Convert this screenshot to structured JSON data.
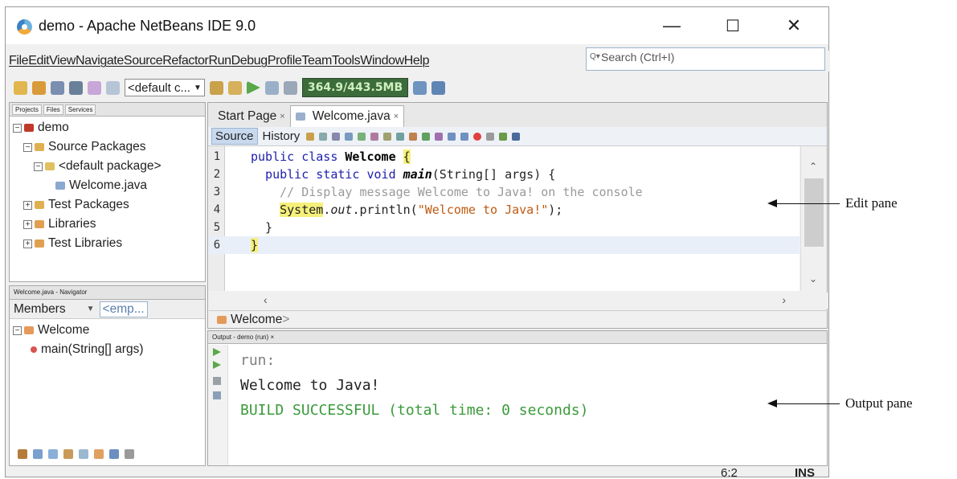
{
  "window": {
    "title": "demo - Apache NetBeans IDE 9.0",
    "minimize": "—",
    "maximize": "☐",
    "close": "✕"
  },
  "menu": [
    "File",
    "Edit",
    "View",
    "Navigate",
    "Source",
    "Refactor",
    "Run",
    "Debug",
    "Profile",
    "Team",
    "Tools",
    "Window",
    "Help"
  ],
  "search": {
    "placeholder": "Search (Ctrl+I)"
  },
  "toolbar": {
    "config": "<default c...",
    "memory": "364.9/443.5MB"
  },
  "projects_panel": {
    "tabs": [
      "Projects",
      "Files",
      "Services"
    ],
    "tree": [
      {
        "label": "demo",
        "toggle": "−",
        "indent": 0
      },
      {
        "label": "Source Packages",
        "toggle": "−",
        "indent": 1
      },
      {
        "label": "<default package>",
        "toggle": "−",
        "indent": 2
      },
      {
        "label": "Welcome.java",
        "toggle": "",
        "indent": 3
      },
      {
        "label": "Test Packages",
        "toggle": "+",
        "indent": 1
      },
      {
        "label": "Libraries",
        "toggle": "+",
        "indent": 1
      },
      {
        "label": "Test Libraries",
        "toggle": "+",
        "indent": 1
      }
    ]
  },
  "navigator": {
    "title": "Welcome.java - Navigator",
    "members_label": "Members",
    "filter": "<emp...",
    "class_name": "Welcome",
    "method": "main(String[] args)"
  },
  "editor": {
    "tabs": [
      "Start Page",
      "Welcome.java"
    ],
    "source_tab": "Source",
    "history_tab": "History",
    "breadcrumb": "Welcome"
  },
  "code": [
    {
      "n": "1",
      "parts": [
        [
          "kw",
          "public class "
        ],
        [
          "bold",
          "Welcome"
        ],
        [
          "",
          " "
        ],
        [
          "hl",
          "{"
        ]
      ]
    },
    {
      "n": "2",
      "parts": [
        [
          "kw",
          "  public static void "
        ],
        [
          "bold it",
          "main"
        ],
        [
          "",
          "(String[] args) {"
        ]
      ]
    },
    {
      "n": "3",
      "parts": [
        [
          "cm",
          "    // Display message Welcome to Java! on the console"
        ]
      ]
    },
    {
      "n": "4",
      "parts": [
        [
          "",
          "    "
        ],
        [
          "hl",
          "System"
        ],
        [
          "",
          "."
        ],
        [
          "it",
          "out"
        ],
        [
          "",
          ".println("
        ],
        [
          "str",
          "\"Welcome to Java!\""
        ],
        [
          "",
          ");"
        ]
      ]
    },
    {
      "n": "5",
      "parts": [
        [
          "",
          "  }"
        ]
      ]
    },
    {
      "n": "6",
      "parts": [
        [
          "hl",
          "}"
        ]
      ]
    }
  ],
  "output": {
    "title": "Output - demo (run)",
    "lines": [
      {
        "text": "run:",
        "color": "#808080"
      },
      {
        "text": "Welcome to Java!",
        "color": "#222222"
      },
      {
        "text": "BUILD SUCCESSFUL (total time: 0 seconds)",
        "color": "#3a9a3a"
      }
    ]
  },
  "status": {
    "position": "6:2",
    "mode": "INS"
  },
  "annotations": {
    "edit": "Edit pane",
    "output": "Output pane"
  }
}
